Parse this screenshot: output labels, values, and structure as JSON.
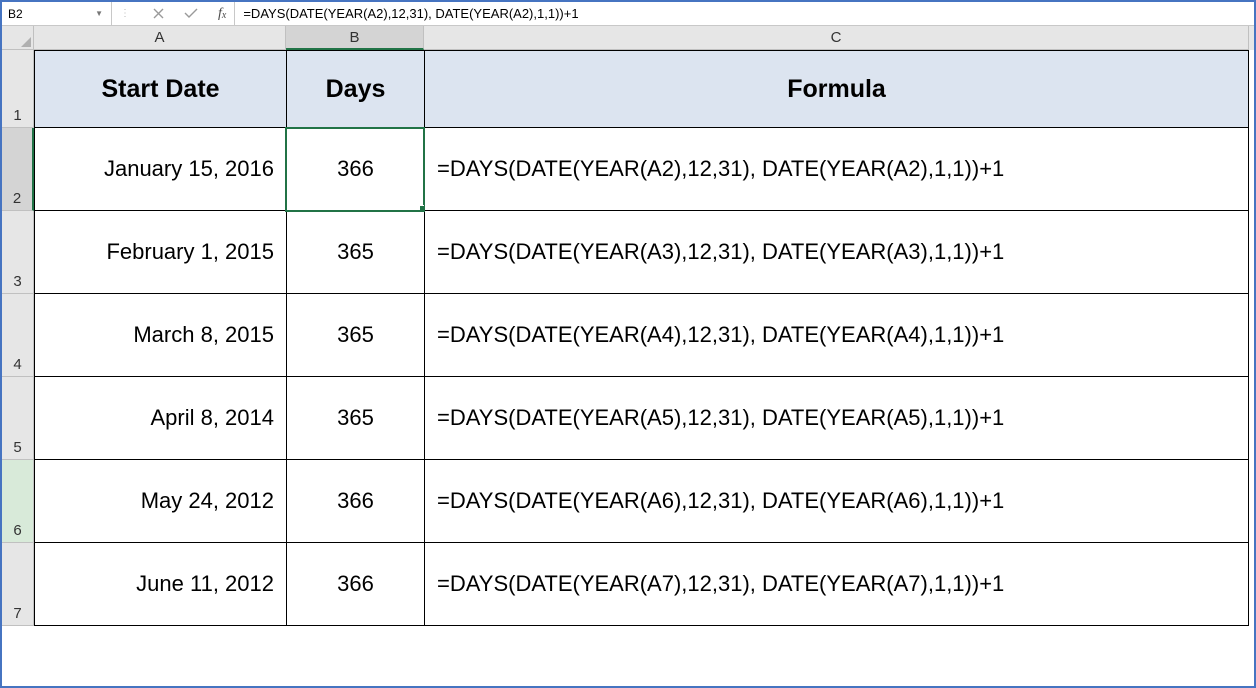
{
  "name_box": {
    "value": "B2"
  },
  "formula_bar": {
    "fx_label": "fx",
    "formula": "=DAYS(DATE(YEAR(A2),12,31), DATE(YEAR(A2),1,1))+1"
  },
  "columns": [
    {
      "letter": "A",
      "active": false
    },
    {
      "letter": "B",
      "active": true
    },
    {
      "letter": "C",
      "active": false
    }
  ],
  "headers": {
    "a": "Start Date",
    "b": "Days",
    "c": "Formula"
  },
  "rows": [
    {
      "n": "1"
    },
    {
      "n": "2",
      "active": true,
      "soft": false,
      "start_date": "January 15, 2016",
      "days": "366",
      "formula": "=DAYS(DATE(YEAR(A2),12,31), DATE(YEAR(A2),1,1))+1"
    },
    {
      "n": "3",
      "active": false,
      "soft": false,
      "start_date": "February 1, 2015",
      "days": "365",
      "formula": "=DAYS(DATE(YEAR(A3),12,31), DATE(YEAR(A3),1,1))+1"
    },
    {
      "n": "4",
      "active": false,
      "soft": false,
      "start_date": "March 8, 2015",
      "days": "365",
      "formula": "=DAYS(DATE(YEAR(A4),12,31), DATE(YEAR(A4),1,1))+1"
    },
    {
      "n": "5",
      "active": false,
      "soft": false,
      "start_date": "April 8, 2014",
      "days": "365",
      "formula": "=DAYS(DATE(YEAR(A5),12,31), DATE(YEAR(A5),1,1))+1"
    },
    {
      "n": "6",
      "active": false,
      "soft": true,
      "start_date": "May 24, 2012",
      "days": "366",
      "formula": "=DAYS(DATE(YEAR(A6),12,31), DATE(YEAR(A6),1,1))+1"
    },
    {
      "n": "7",
      "active": false,
      "soft": false,
      "start_date": "June 11, 2012",
      "days": "366",
      "formula": "=DAYS(DATE(YEAR(A7),12,31), DATE(YEAR(A7),1,1))+1"
    }
  ],
  "selected_cell": "B2"
}
